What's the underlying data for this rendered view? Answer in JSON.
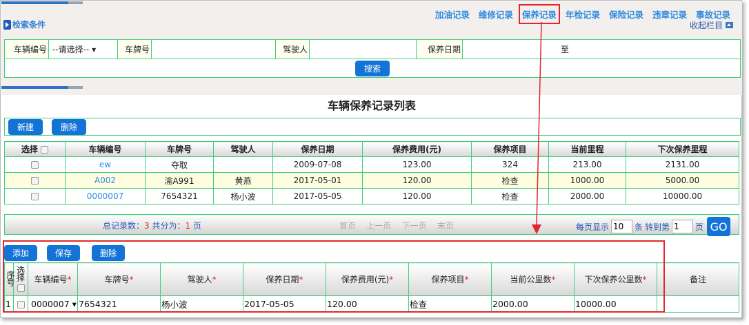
{
  "nav": {
    "links": [
      "加油记录",
      "维修记录",
      "保养记录",
      "年检记录",
      "保险记录",
      "违章记录",
      "事故记录"
    ],
    "active": "保养记录",
    "collapse": "收起栏目"
  },
  "search": {
    "title": "检索条件",
    "vehicle_no_label": "车辆编号",
    "vehicle_no_value": "--请选择--",
    "plate_label": "车牌号",
    "driver_label": "驾驶人",
    "date_label": "保养日期",
    "date_to": "至",
    "search_button": "搜索"
  },
  "list": {
    "title": "车辆保养记录列表",
    "new_button": "新建",
    "delete_button": "删除",
    "columns": [
      "选择",
      "车辆编号",
      "车牌号",
      "驾驶人",
      "保养日期",
      "保养费用(元)",
      "保养项目",
      "当前里程",
      "下次保养里程"
    ],
    "rows": [
      [
        "ew",
        "夺取",
        "",
        "2009-07-08",
        "123.00",
        "324",
        "213.00",
        "2131.00"
      ],
      [
        "A002",
        "渝A991",
        "黄燕",
        "2017-05-01",
        "120.00",
        "检查",
        "1000.00",
        "5000.00"
      ],
      [
        "0000007",
        "7654321",
        "杨小波",
        "2017-05-05",
        "120.00",
        "检查",
        "2000.00",
        "10000.00"
      ]
    ]
  },
  "pager": {
    "total_label": "总记录数：",
    "total": "3",
    "pages_label": "共分为：",
    "pages": "1",
    "pages_unit": "页",
    "first": "首页",
    "prev": "上一页",
    "next": "下一页",
    "last": "末页",
    "per_page_label": "每页显示",
    "per_page": "10",
    "per_page_unit": "条",
    "goto_label": "转到第",
    "goto_page": "1",
    "goto_unit": "页",
    "go": "GO"
  },
  "editor": {
    "add_button": "添加",
    "save_button": "保存",
    "delete_button": "删除",
    "columns": [
      "序号",
      "选择",
      "车辆编号",
      "车牌号",
      "驾驶人",
      "保养日期",
      "保养费用(元)",
      "保养项目",
      "当前公里数",
      "下次保养公里数",
      "备注"
    ],
    "required": "*",
    "row": [
      "1",
      "0000007",
      "7654321",
      "杨小波",
      "2017-05-05",
      "120.00",
      "检查",
      "2000.00",
      "10000.00",
      ""
    ]
  },
  "colors": {
    "accent": "#1473d6",
    "link": "#2f8be0",
    "border": "#3fcf7c",
    "highlight": "#e3262d"
  }
}
